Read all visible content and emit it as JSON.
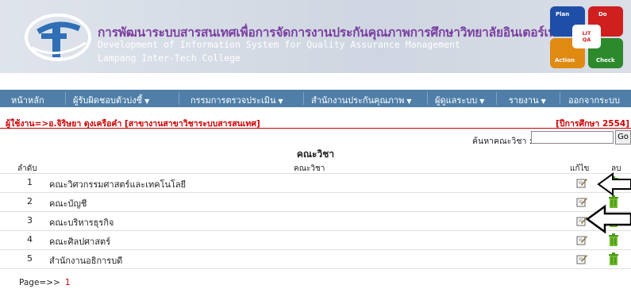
{
  "header": {
    "title_th": "การพัฒนาระบบสารสนเทศเพื่อการจัดการงานประกันคุณภาพการศึกษาวิทยาลัยอินเตอร์เทคลำปาง",
    "title_en": "Development of Information System for Quality Assurance Management",
    "college": "Lampang Inter-Tech College",
    "pdca": {
      "plan": "Plan",
      "do": "Do",
      "action": "Action",
      "check": "Check",
      "center_top": "LIT",
      "center_bottom": "QA"
    }
  },
  "nav": {
    "items": [
      {
        "label": "หน้าหลัก",
        "dropdown": false
      },
      {
        "label": "ผู้รับผิดชอบตัวบ่งชี้",
        "dropdown": true
      },
      {
        "label": "กรรมการตรวจประเมิน",
        "dropdown": true
      },
      {
        "label": "สำนักงานประกันคุณภาพ",
        "dropdown": true
      },
      {
        "label": "ผู้ดูแลระบบ",
        "dropdown": true
      },
      {
        "label": "รายงาน",
        "dropdown": true
      },
      {
        "label": "ออกจากระบบ",
        "dropdown": false
      }
    ]
  },
  "user_line": "ผู้ใช้งาน=>อ.จิริษยา ดุงเครือคำ [สาขางานสาขาวิชาระบบสารสนเทศ]",
  "year_line": "[ปีการศึกษา 2554]",
  "search": {
    "label": "ค้นหาคณะวิชา :",
    "value": "",
    "button": "Go"
  },
  "page_title": "คณะวิชา",
  "table": {
    "headers": {
      "order": "ลำดับ",
      "name": "คณะวิชา",
      "edit": "แก้ไข",
      "delete": "ลบ"
    },
    "rows": [
      {
        "num": "1",
        "name": "คณะวิศวกรรมศาสตร์และเทคโนโลยี"
      },
      {
        "num": "2",
        "name": "คณะบัญชี"
      },
      {
        "num": "3",
        "name": "คณะบริหารธุรกิจ"
      },
      {
        "num": "4",
        "name": "คณะศิลปศาสตร์"
      },
      {
        "num": "5",
        "name": "สำนักงานอธิการบดี"
      }
    ]
  },
  "pager": {
    "label": "Page=>>",
    "current": "1"
  },
  "colors": {
    "nav": "#4f7fa8",
    "accent_red": "#cc0000",
    "header_bg": "#d7dde7",
    "title": "#7a3ea0"
  }
}
